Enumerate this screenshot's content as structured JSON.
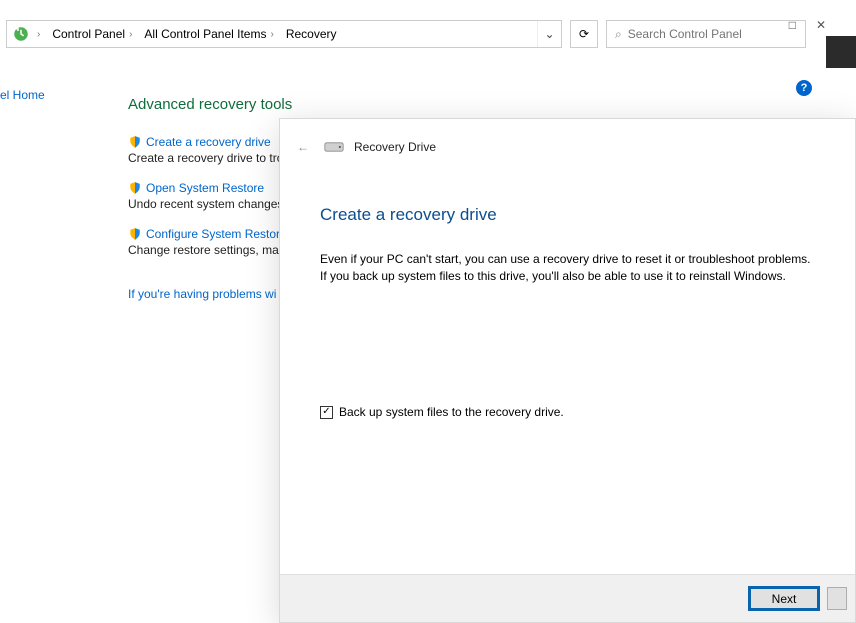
{
  "window": {
    "maximize_glyph": "□",
    "close_glyph": "✕"
  },
  "breadcrumb": {
    "items": [
      {
        "label": "Control Panel"
      },
      {
        "label": "All Control Panel Items"
      },
      {
        "label": "Recovery"
      }
    ]
  },
  "addr": {
    "dropdown_glyph": "⌄",
    "refresh_glyph": "⟳"
  },
  "search": {
    "placeholder": "Search Control Panel",
    "icon": "🔍"
  },
  "help": {
    "glyph": "?"
  },
  "sidebar": {
    "home": "el Home"
  },
  "page": {
    "heading": "Advanced recovery tools",
    "tools": [
      {
        "link": "Create a recovery drive",
        "desc": "Create a recovery drive to tro"
      },
      {
        "link": "Open System Restore",
        "desc": "Undo recent system changes"
      },
      {
        "link": "Configure System Restore",
        "desc": "Change restore settings, man"
      }
    ],
    "troubleshoot": "If you're having problems wi"
  },
  "wizard": {
    "back_glyph": "←",
    "title": "Recovery Drive",
    "heading": "Create a recovery drive",
    "body": "Even if your PC can't start, you can use a recovery drive to reset it or troubleshoot problems. If you back up system files to this drive, you'll also be able to use it to reinstall Windows.",
    "checkbox": {
      "checked": true,
      "label": "Back up system files to the recovery drive.",
      "glyph": "✓"
    },
    "buttons": {
      "next": "Next"
    }
  }
}
